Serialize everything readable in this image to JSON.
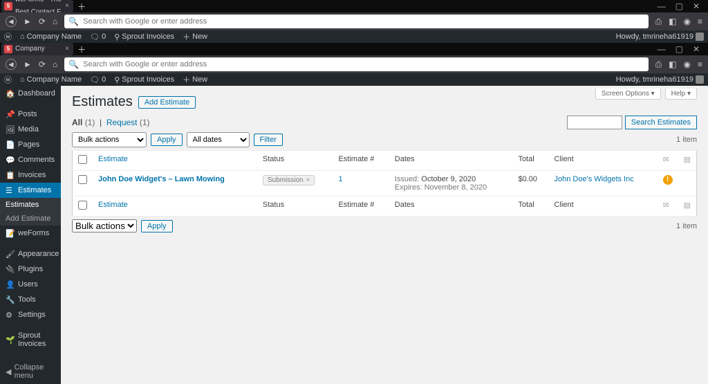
{
  "browser": {
    "tab1_title": "weForms - The Best Contact F",
    "tab2_title": "Estimates ‹ Company Name —",
    "url_placeholder": "Search with Google or enter address"
  },
  "wp_bar": {
    "site_name": "Company Name",
    "comments_count": "0",
    "sprout_label": "Sprout Invoices",
    "new_label": "New",
    "howdy": "Howdy, tmrineha61919"
  },
  "sidebar": {
    "dashboard": "Dashboard",
    "posts": "Posts",
    "media": "Media",
    "pages": "Pages",
    "comments": "Comments",
    "invoices": "Invoices",
    "estimates": "Estimates",
    "estimates_sub_list": "Estimates",
    "estimates_sub_add": "Add Estimate",
    "weforms": "weForms",
    "appearance": "Appearance",
    "plugins": "Plugins",
    "users": "Users",
    "tools": "Tools",
    "settings": "Settings",
    "sprout_invoices": "Sprout Invoices",
    "collapse": "Collapse menu"
  },
  "page": {
    "title": "Estimates",
    "add_button": "Add Estimate",
    "screen_options": "Screen Options ▾",
    "help": "Help ▾",
    "filter_all": "All",
    "filter_all_count": "(1)",
    "filter_request": "Request",
    "filter_request_count": "(1)",
    "bulk_actions": "Bulk actions",
    "apply": "Apply",
    "all_dates": "All dates",
    "filter": "Filter",
    "item_count": "1 item",
    "search_button": "Search Estimates"
  },
  "columns": {
    "estimate": "Estimate",
    "status": "Status",
    "estimate_no": "Estimate #",
    "dates": "Dates",
    "total": "Total",
    "client": "Client"
  },
  "row": {
    "title": "John Doe Widget's – Lawn Mowing",
    "status": "Submission",
    "number": "1",
    "issued_label": "Issued:",
    "issued_date": "October 9, 2020",
    "expires_label": "Expires:",
    "expires_date": "November 8, 2020",
    "total": "$0.00",
    "client": "John Doe's Widgets Inc"
  }
}
